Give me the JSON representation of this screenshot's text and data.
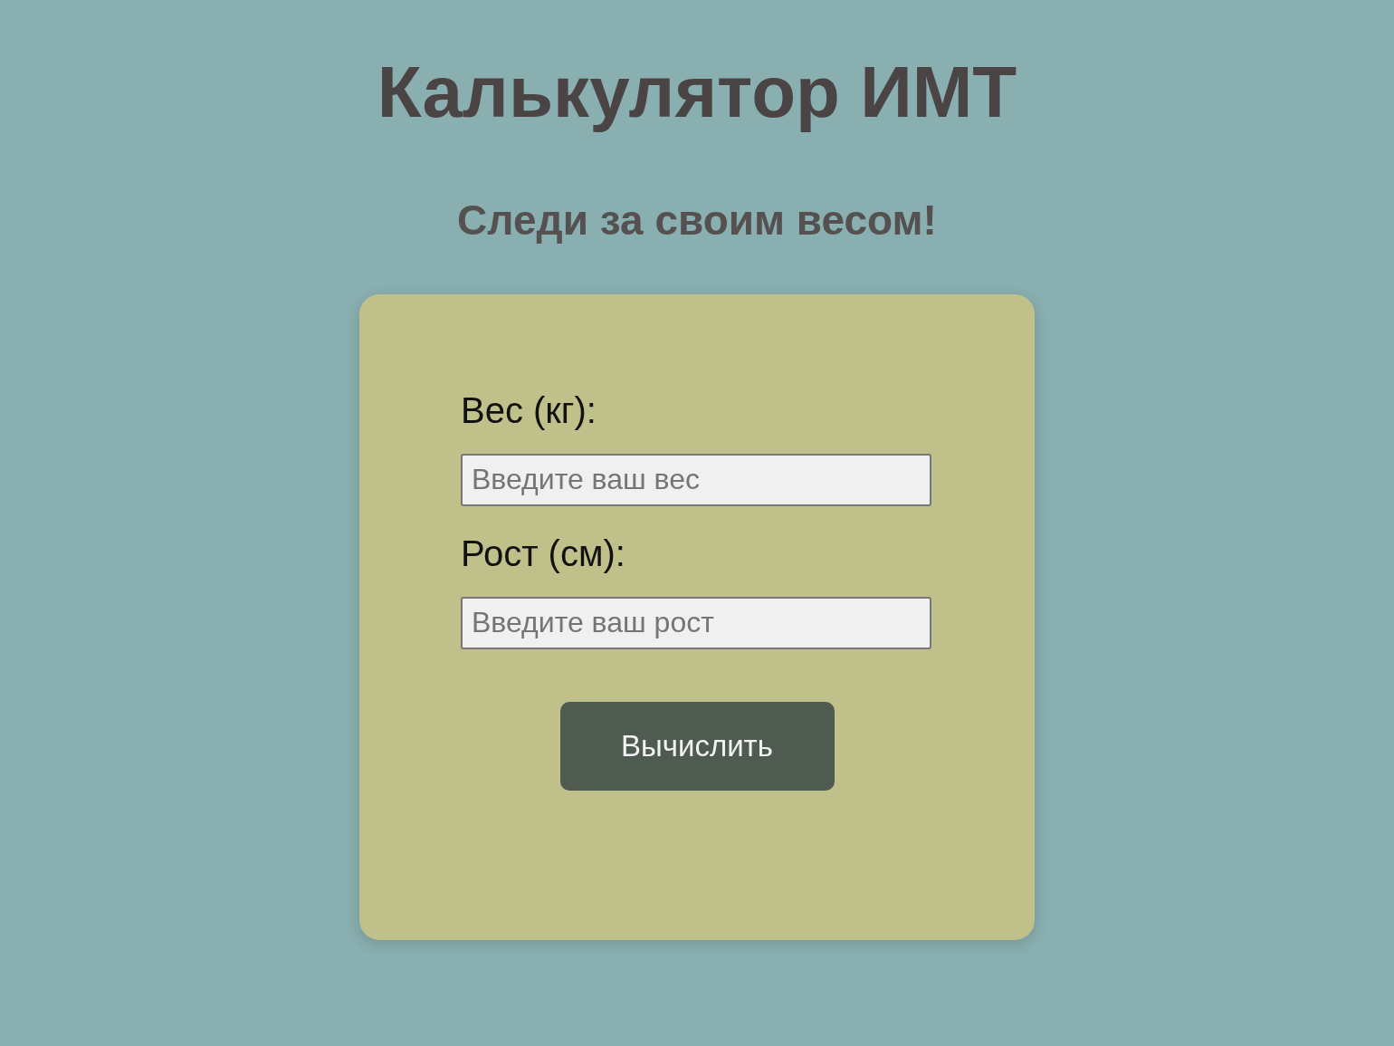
{
  "title": "Калькулятор ИМТ",
  "subtitle": "Следи за своим весом!",
  "fields": [
    {
      "label": "Вес (кг):",
      "placeholder": "Введите ваш вес"
    },
    {
      "label": "Рост (см):",
      "placeholder": "Введите ваш рост"
    }
  ],
  "button": "Вычислить"
}
